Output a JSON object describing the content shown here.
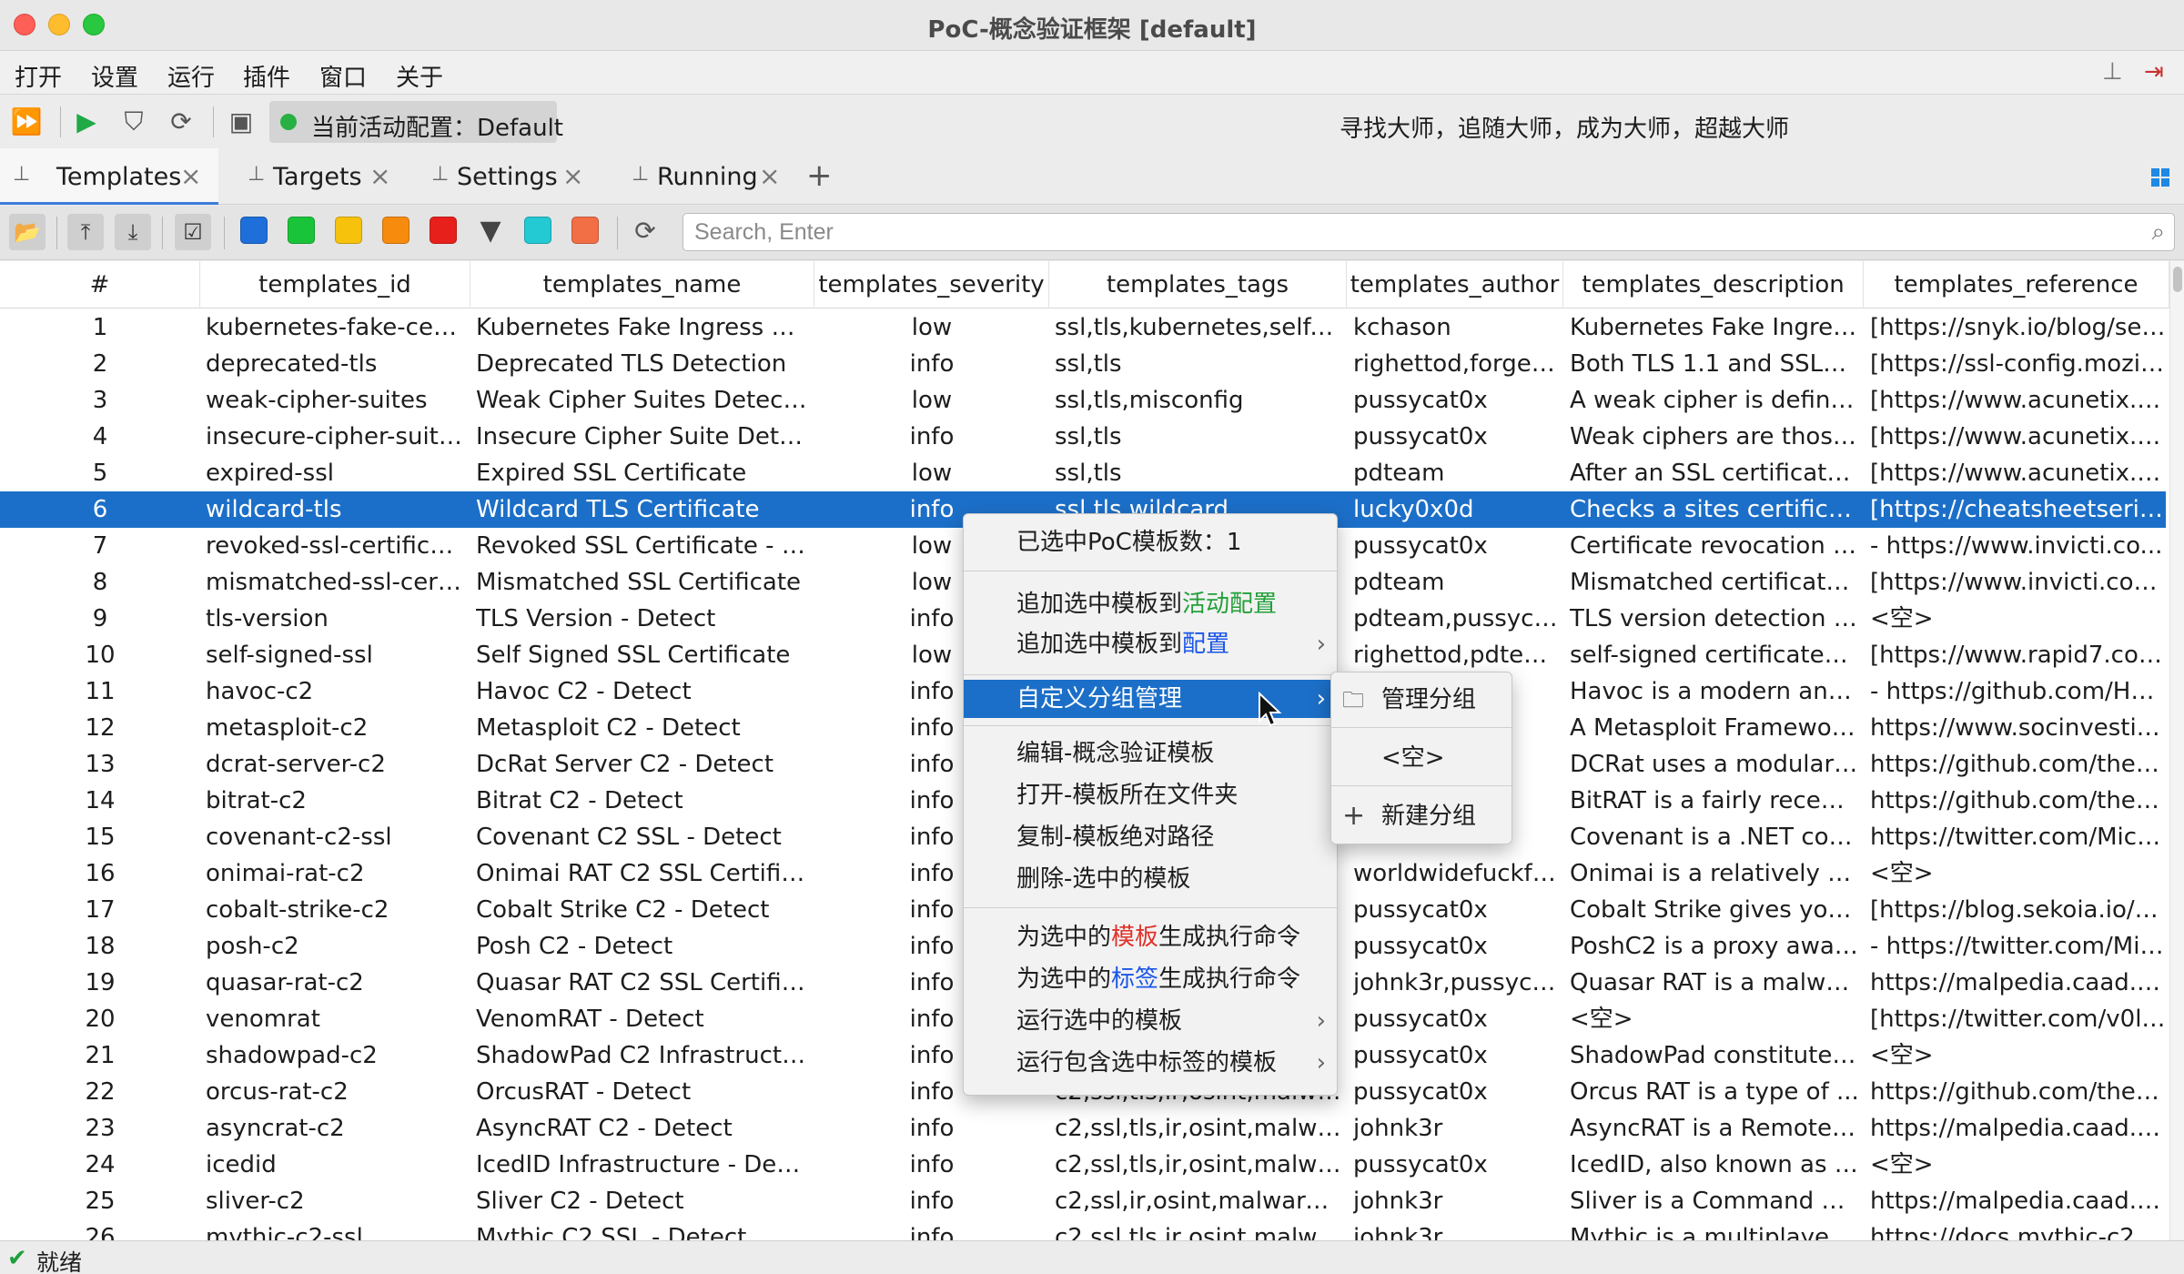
{
  "window": {
    "title": "PoC-概念验证框架 [default]"
  },
  "menubar": {
    "items": [
      "打开",
      "设置",
      "运行",
      "插件",
      "窗口",
      "关于"
    ]
  },
  "toolbar": {
    "active_config_label": "当前活动配置：Default",
    "slogan": "寻找大师，追随大师，成为大师，超越大师"
  },
  "tabs": [
    {
      "label": "Templates",
      "active": true
    },
    {
      "label": "Targets",
      "active": false
    },
    {
      "label": "Settings",
      "active": false
    },
    {
      "label": "Running",
      "active": false
    }
  ],
  "filter_colors": [
    "#1e6fd9",
    "#19c43a",
    "#f7c20c",
    "#f78b0e",
    "#e8201c",
    "#23c9d3",
    "#f26e45"
  ],
  "search": {
    "placeholder": "Search, Enter"
  },
  "table": {
    "columns": [
      "#",
      "templates_id",
      "templates_name",
      "templates_severity",
      "templates_tags",
      "templates_author",
      "templates_description",
      "templates_reference"
    ],
    "selected_row": 6,
    "rows": [
      [
        "1",
        "kubernetes-fake-certif...",
        "Kubernetes Fake Ingress Cer...",
        "low",
        "ssl,tls,kubernetes,self-si...",
        "kchason",
        "Kubernetes Fake Ingress...",
        "[https://snyk.io/blog/setti..."
      ],
      [
        "2",
        "deprecated-tls",
        "Deprecated TLS Detection",
        "info",
        "ssl,tls",
        "righettod,forgedh...",
        "Both TLS 1.1 and SSLv3 ...",
        "[https://ssl-config.mozilla..."
      ],
      [
        "3",
        "weak-cipher-suites",
        "Weak Cipher Suites Detection",
        "low",
        "ssl,tls,misconfig",
        "pussycat0x",
        "A weak cipher is defined...",
        "[https://www.acunetix.co..."
      ],
      [
        "4",
        "insecure-cipher-suite-...",
        "Insecure Cipher Suite Detection",
        "info",
        "ssl,tls",
        "pussycat0x",
        "Weak ciphers are those ...",
        "[https://www.acunetix.co..."
      ],
      [
        "5",
        "expired-ssl",
        "Expired SSL Certificate",
        "low",
        "ssl,tls",
        "pdteam",
        "After an SSL certificate e...",
        "[https://www.acunetix.co..."
      ],
      [
        "6",
        "wildcard-tls",
        "Wildcard TLS Certificate",
        "info",
        "ssl,tls,wildcard",
        "lucky0x0d",
        "Checks a sites certificat...",
        "[https://cheatsheetseries...."
      ],
      [
        "7",
        "revoked-ssl-certificate",
        "Revoked SSL Certificate - De...",
        "low",
        "",
        "pussycat0x",
        "Certificate revocation is t...",
        "- https://www.invicti.co..."
      ],
      [
        "8",
        "mismatched-ssl-certifi...",
        "Mismatched SSL Certificate",
        "low",
        "",
        "pdteam",
        "Mismatched certificates ...",
        "[https://www.invicti.com/..."
      ],
      [
        "9",
        "tls-version",
        "TLS Version - Detect",
        "info",
        "",
        "pdteam,pussyca...",
        "TLS version detection is ...",
        "<空>"
      ],
      [
        "10",
        "self-signed-ssl",
        "Self Signed SSL Certificate",
        "low",
        "",
        "righettod,pdteam",
        "self-signed certificates a...",
        "[https://www.rapid7.com..."
      ],
      [
        "11",
        "havoc-c2",
        "Havoc C2 - Detect",
        "info",
        "",
        "",
        "Havoc is a modern and ...",
        "- https://github.com/Hav..."
      ],
      [
        "12",
        "metasploit-c2",
        "Metasploit C2 - Detect",
        "info",
        "",
        "",
        "A Metasploit Framework ...",
        "https://www.socinvestig..."
      ],
      [
        "13",
        "dcrat-server-c2",
        "DcRat Server C2 - Detect",
        "info",
        "",
        "",
        "DCRat uses a modular fr...",
        "https://github.com/theha..."
      ],
      [
        "14",
        "bitrat-c2",
        "Bitrat C2 - Detect",
        "info",
        "",
        "",
        "BitRAT is a fairly recent, ...",
        "https://github.com/theha..."
      ],
      [
        "15",
        "covenant-c2-ssl",
        "Covenant C2 SSL - Detect",
        "info",
        "",
        "",
        "Covenant is a .NET com...",
        "https://twitter.com/Micha..."
      ],
      [
        "16",
        "onimai-rat-c2",
        "Onimai RAT C2 SSL Certifica...",
        "info",
        "",
        "worldwidefuckfest",
        "Onimai is a relatively ne...",
        "<空>"
      ],
      [
        "17",
        "cobalt-strike-c2",
        "Cobalt Strike C2 - Detect",
        "info",
        "",
        "pussycat0x",
        "Cobalt Strike gives you a...",
        "[https://blog.sekoia.io/hu..."
      ],
      [
        "18",
        "posh-c2",
        "Posh C2 - Detect",
        "info",
        "",
        "pussycat0x",
        "PoshC2 is a proxy aware...",
        "- https://twitter.com/Mic..."
      ],
      [
        "19",
        "quasar-rat-c2",
        "Quasar RAT C2 SSL Certifica...",
        "info",
        "",
        "johnk3r,pussycat...",
        "Quasar RAT is a malwar...",
        "https://malpedia.caad.fk..."
      ],
      [
        "20",
        "venomrat",
        "VenomRAT - Detect",
        "info",
        "",
        "pussycat0x",
        "<空>",
        "[https://twitter.com/v0lun..."
      ],
      [
        "21",
        "shadowpad-c2",
        "ShadowPad C2 Infrastructure...",
        "info",
        "",
        "pussycat0x",
        "ShadowPad constitutes ...",
        "<空>"
      ],
      [
        "22",
        "orcus-rat-c2",
        "OrcusRAT - Detect",
        "info",
        "c2,ssl,tls,ir,osint,malwar...",
        "pussycat0x",
        "Orcus RAT is a type of ...",
        "https://github.com/theha..."
      ],
      [
        "23",
        "asyncrat-c2",
        "AsyncRAT C2 - Detect",
        "info",
        "c2,ssl,tls,ir,osint,malwar...",
        "johnk3r",
        "AsyncRAT is a Remote A...",
        "https://malpedia.caad.fk..."
      ],
      [
        "24",
        "icedid",
        "IcedID Infrastructure - Detect",
        "info",
        "c2,ssl,tls,ir,osint,malwar...",
        "pussycat0x",
        "IcedID, also known as B...",
        "<空>"
      ],
      [
        "25",
        "sliver-c2",
        "Sliver C2 - Detect",
        "info",
        "c2,ssl,ir,osint,malware,sl...",
        "johnk3r",
        "Sliver is a Command and...",
        "https://malpedia.caad.fk..."
      ],
      [
        "26",
        "mythic-c2-ssl",
        "Mythic C2 SSL - Detect",
        "info",
        "c2,ssl,tls,ir,osint,malwar...",
        "johnk3r",
        "Mythic is a multiplayer, c...",
        "https://docs.mythic-c2.n..."
      ]
    ]
  },
  "context_menu": {
    "selected_count": "已选中PoC模板数：1",
    "append_active_prefix": "追加选中模板到",
    "append_active_highlight": "活动配置",
    "append_config_prefix": "追加选中模板到",
    "append_config_highlight": "配置",
    "custom_group": "自定义分组管理",
    "edit": "编辑-概念验证模板",
    "open_folder": "打开-模板所在文件夹",
    "copy_path": "复制-模板绝对路径",
    "delete": "删除-选中的模板",
    "cmd_template_prefix": "为选中的",
    "cmd_template_highlight": "模板",
    "cmd_template_suffix": "生成执行命令",
    "cmd_tag_prefix": "为选中的",
    "cmd_tag_highlight": "标签",
    "cmd_tag_suffix": "生成执行命令",
    "run_selected": "运行选中的模板",
    "run_tagged": "运行包含选中标签的模板"
  },
  "submenu": {
    "manage": "管理分组",
    "empty": "<空>",
    "new_group": "新建分组"
  },
  "status": {
    "text": "就绪"
  }
}
